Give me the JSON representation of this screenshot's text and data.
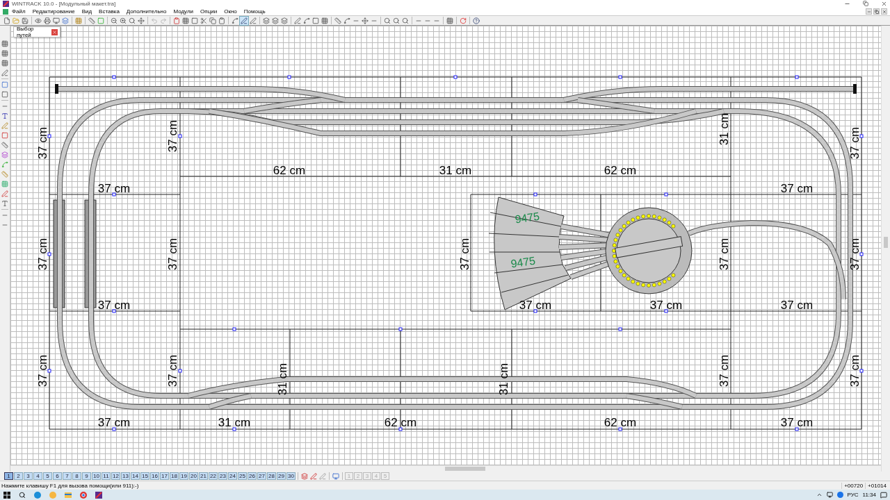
{
  "window": {
    "title": "WINTRACK 10.0 - [Модульный макет.tra]"
  },
  "menu": [
    "Файл",
    "Редактирование",
    "Вид",
    "Вставка",
    "Дополнительно",
    "Модули",
    "Опции",
    "Окно",
    "Помощь"
  ],
  "floating_panel": {
    "title": "Выбор путей"
  },
  "canvas": {
    "dimension_labels": [
      {
        "text": "37 cm",
        "kind": "vertical"
      },
      {
        "text": "37 cm",
        "kind": "vertical"
      },
      {
        "text": "31 cm",
        "kind": "vertical"
      },
      {
        "text": "37 cm",
        "kind": "vertical"
      },
      {
        "text": "62 cm",
        "kind": "horizontal"
      },
      {
        "text": "31 cm",
        "kind": "horizontal"
      },
      {
        "text": "62 cm",
        "kind": "horizontal"
      },
      {
        "text": "37 cm",
        "kind": "horizontal"
      },
      {
        "text": "37 cm",
        "kind": "horizontal"
      },
      {
        "text": "37 cm",
        "kind": "vertical"
      },
      {
        "text": "37 cm",
        "kind": "vertical"
      },
      {
        "text": "37 cm",
        "kind": "vertical"
      },
      {
        "text": "37 cm",
        "kind": "vertical"
      },
      {
        "text": "37 cm",
        "kind": "vertical"
      },
      {
        "text": "37 cm",
        "kind": "horizontal"
      },
      {
        "text": "37 cm",
        "kind": "horizontal"
      },
      {
        "text": "37 cm",
        "kind": "horizontal"
      },
      {
        "text": "37 cm",
        "kind": "horizontal"
      },
      {
        "text": "37 cm",
        "kind": "vertical"
      },
      {
        "text": "37 cm",
        "kind": "vertical"
      },
      {
        "text": "31 cm",
        "kind": "vertical"
      },
      {
        "text": "31 cm",
        "kind": "vertical"
      },
      {
        "text": "37 cm",
        "kind": "vertical"
      },
      {
        "text": "37 cm",
        "kind": "vertical"
      },
      {
        "text": "37 cm",
        "kind": "horizontal"
      },
      {
        "text": "31 cm",
        "kind": "horizontal"
      },
      {
        "text": "62 cm",
        "kind": "horizontal"
      },
      {
        "text": "62 cm",
        "kind": "horizontal"
      },
      {
        "text": "37 cm",
        "kind": "horizontal"
      }
    ],
    "track_labels": [
      "9475",
      "9475"
    ]
  },
  "layer_tabs": [
    {
      "label": "1",
      "selected": true
    },
    {
      "label": "2",
      "selected": false
    },
    {
      "label": "3",
      "selected": false
    },
    {
      "label": "4",
      "selected": false
    },
    {
      "label": "5",
      "selected": false
    },
    {
      "label": "6",
      "selected": false
    },
    {
      "label": "7",
      "selected": false
    },
    {
      "label": "8",
      "selected": false
    },
    {
      "label": "9",
      "selected": false
    },
    {
      "label": "10",
      "selected": false
    },
    {
      "label": "11",
      "selected": false
    },
    {
      "label": "12",
      "selected": false
    },
    {
      "label": "13",
      "selected": false
    },
    {
      "label": "14",
      "selected": false
    },
    {
      "label": "15",
      "selected": false
    },
    {
      "label": "16",
      "selected": false
    },
    {
      "label": "17",
      "selected": false
    },
    {
      "label": "18",
      "selected": false
    },
    {
      "label": "19",
      "selected": false
    },
    {
      "label": "20",
      "selected": false
    },
    {
      "label": "21",
      "selected": false
    },
    {
      "label": "22",
      "selected": false
    },
    {
      "label": "23",
      "selected": false
    },
    {
      "label": "24",
      "selected": false
    },
    {
      "label": "25",
      "selected": false
    },
    {
      "label": "26",
      "selected": false
    },
    {
      "label": "27",
      "selected": false
    },
    {
      "label": "28",
      "selected": false
    },
    {
      "label": "29",
      "selected": false
    },
    {
      "label": "30",
      "selected": false
    }
  ],
  "page_buttons": [
    {
      "label": "1",
      "disabled": true
    },
    {
      "label": "2",
      "disabled": true
    },
    {
      "label": "3",
      "disabled": true
    },
    {
      "label": "4",
      "disabled": true
    },
    {
      "label": "5",
      "disabled": true
    }
  ],
  "status_bar": {
    "hint": "Нажмите клавишу F1 для вызова помощи(или 911):-)",
    "coord_x": "+00720",
    "coord_y": "+01014"
  },
  "taskbar": {
    "language": "РУС",
    "time": "11:34"
  }
}
